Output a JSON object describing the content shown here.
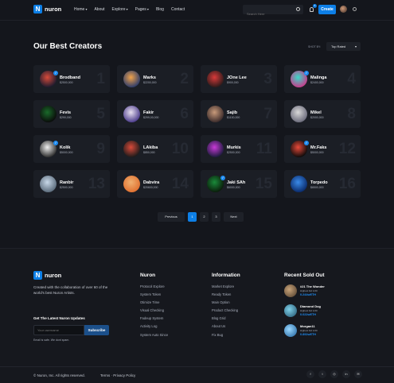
{
  "header": {
    "logo_letter": "N",
    "logo_text": "nuron",
    "nav": [
      "Home",
      "About",
      "Explore",
      "Pages",
      "Blog",
      "Contact"
    ],
    "search_placeholder": "Search Here",
    "bell_count": "5",
    "create_label": "Create"
  },
  "main": {
    "title": "Our Best Creators",
    "sort_label": "SHOT BY:",
    "sort_value": "Top Rated"
  },
  "creators": [
    {
      "name": "Brodband",
      "price": "$2500,000",
      "num": "1"
    },
    {
      "name": "Marks",
      "price": "$2200,000",
      "num": "2"
    },
    {
      "name": "JOne Lee",
      "price": "$900,000",
      "num": "3"
    },
    {
      "name": "Malinga",
      "price": "$2400,000",
      "num": "4"
    },
    {
      "name": "Fevis",
      "price": "$290,000",
      "num": "5"
    },
    {
      "name": "Fakir",
      "price": "$299,00,000",
      "num": "6"
    },
    {
      "name": "Sajib",
      "price": "$1100,000",
      "num": "7"
    },
    {
      "name": "Mikel",
      "price": "$2000,000",
      "num": "8"
    },
    {
      "name": "Kolik",
      "price": "$5000,000",
      "num": "9"
    },
    {
      "name": "LAkiba",
      "price": "$850,000",
      "num": "10"
    },
    {
      "name": "Murkis",
      "price": "$2500,000",
      "num": "11"
    },
    {
      "name": "Mr.Faks",
      "price": "$5000,000",
      "num": "12"
    },
    {
      "name": "Ranbir",
      "price": "$2500,000",
      "num": "13"
    },
    {
      "name": "Dabvira",
      "price": "$20600,000",
      "num": "14"
    },
    {
      "name": "Jaki SAh",
      "price": "$6000,000",
      "num": "15"
    },
    {
      "name": "Torpedo",
      "price": "$6500,000",
      "num": "16"
    }
  ],
  "pagination": {
    "prev": "Previous",
    "pages": [
      "1",
      "2",
      "3"
    ],
    "next": "Next"
  },
  "footer": {
    "logo_text": "nuron",
    "description": "Created with the collaboration of over 60 of the world's best Nuron Artists.",
    "updates_title": "Get The Latest Nuron Updates",
    "email_placeholder": "Your username",
    "subscribe_label": "Subscribe",
    "safe_text": "Email is safe. We dont spam.",
    "col1": {
      "title": "Nuron",
      "links": [
        "Protocol Explore",
        "System Token",
        "Otimize Time",
        "Visual Checking",
        "Fadeup System",
        "Activity Log",
        "System Auto Since"
      ]
    },
    "col2": {
      "title": "Information",
      "links": [
        "Market Explore",
        "Ready Token",
        "Main Option",
        "Product Checking",
        "Blog Grid",
        "About Us",
        "Fix Bug"
      ]
    },
    "sold_title": "Recent Sold Out",
    "sold": [
      {
        "title": "#21 The Wonder",
        "highest": "Highest bid 1/20",
        "eth": "0.244wETH"
      },
      {
        "title": "Diamond Dog",
        "highest": "Highest bid 1/20",
        "eth": "0.022wETH"
      },
      {
        "title": "Morgan11",
        "highest": "Highest bid 1/20",
        "eth": "0.892wETH"
      }
    ],
    "copyright": "© Nuron, Inc. All rights reserved.",
    "terms": "Terms",
    "privacy": "Privacy Policy"
  }
}
